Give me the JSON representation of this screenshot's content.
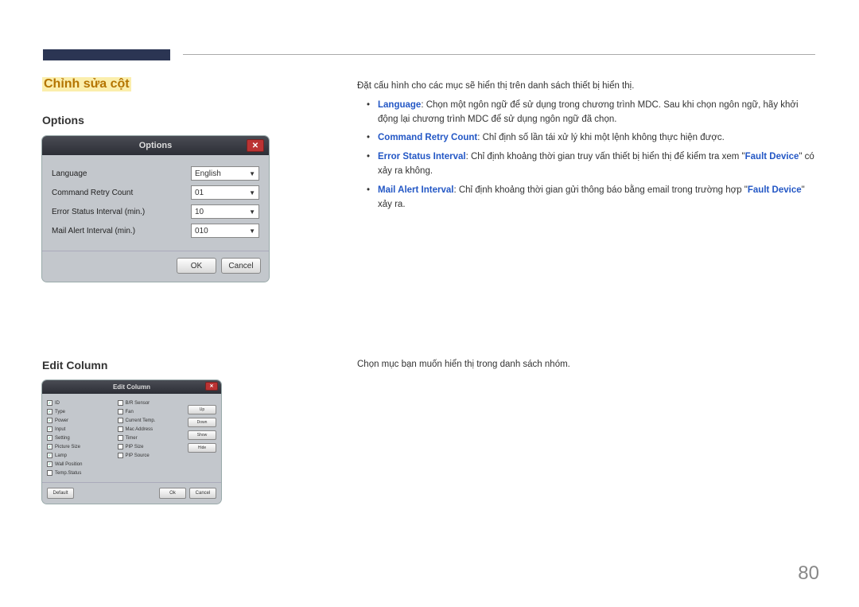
{
  "section_title": "Chỉnh sửa cột",
  "subheading_options": "Options",
  "subheading_edit": "Edit Column",
  "options_dialog": {
    "title": "Options",
    "rows": {
      "language": {
        "label": "Language",
        "value": "English"
      },
      "retry": {
        "label": "Command Retry Count",
        "value": "01"
      },
      "error": {
        "label": "Error Status Interval (min.)",
        "value": "10"
      },
      "mail": {
        "label": "Mail Alert Interval (min.)",
        "value": "010"
      }
    },
    "ok": "OK",
    "cancel": "Cancel"
  },
  "edit_dialog": {
    "title": "Edit Column",
    "col1": [
      {
        "label": "ID",
        "checked": true
      },
      {
        "label": "Type",
        "checked": true
      },
      {
        "label": "Power",
        "checked": true
      },
      {
        "label": "Input",
        "checked": true
      },
      {
        "label": "Setting",
        "checked": true
      },
      {
        "label": "Picture Size",
        "checked": true
      },
      {
        "label": "Lamp",
        "checked": true
      },
      {
        "label": "Wall Position",
        "checked": true
      },
      {
        "label": "Temp.Status",
        "checked": false
      }
    ],
    "col2": [
      {
        "label": "B/R Sensor",
        "checked": false
      },
      {
        "label": "Fan",
        "checked": false
      },
      {
        "label": "Current Temp.",
        "checked": false
      },
      {
        "label": "Mac Address",
        "checked": false
      },
      {
        "label": "Timer",
        "checked": false
      },
      {
        "label": "PIP Size",
        "checked": false
      },
      {
        "label": "PIP Source",
        "checked": false
      }
    ],
    "side": {
      "up": "Up",
      "down": "Down",
      "show": "Show",
      "hide": "Hide"
    },
    "default": "Default",
    "ok": "Ok",
    "cancel": "Cancel"
  },
  "right": {
    "intro": "Đặt cấu hình cho các mục sẽ hiển thị trên danh sách thiết bị hiển thị.",
    "b1_bold": "Language",
    "b1_rest": ": Chọn một ngôn ngữ để sử dụng trong chương trình MDC. Sau khi chọn ngôn ngữ, hãy khởi động lại chương trình MDC để sử dụng ngôn ngữ đã chọn.",
    "b2_bold": "Command Retry Count",
    "b2_rest": ": Chỉ định số lần tái xử lý khi một lệnh không thực hiện được.",
    "b3_bold": "Error Status Interval",
    "b3_mid": ": Chỉ định khoảng thời gian truy vấn thiết bị hiển thị để kiểm tra xem \"",
    "b3_fault": "Fault Device",
    "b3_end": "\" có xảy ra không.",
    "b4_bold": "Mail Alert Interval",
    "b4_mid": ": Chỉ định khoảng thời gian gửi thông báo bằng email trong trường hợp \"",
    "b4_fault": "Fault Device",
    "b4_end": "\" xảy ra."
  },
  "right2": "Chọn mục bạn muốn hiển thị trong danh sách nhóm.",
  "page_number": "80"
}
